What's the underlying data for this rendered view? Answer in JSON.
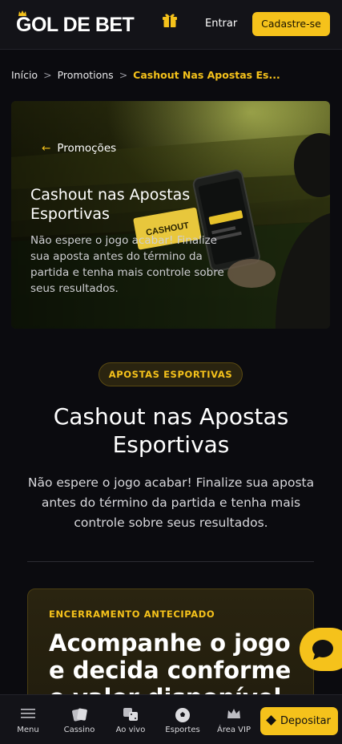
{
  "header": {
    "logo_text": "GOL DE BET",
    "login_label": "Entrar",
    "signup_label": "Cadastre-se",
    "accent_color": "#f5c21b"
  },
  "breadcrumb": {
    "items": [
      "Início",
      "Promotions",
      "Cashout Nas Apostas Es..."
    ],
    "separator": ">"
  },
  "hero": {
    "back_label": "Promoções",
    "title": "Cashout nas Apostas Esportivas",
    "description": "Não espere o jogo acabar! Finalize sua aposta antes do término da partida e tenha mais controle sobre seus resultados.",
    "image_ticket_text": "CASHOUT"
  },
  "main": {
    "badge": "APOSTAS ESPORTIVAS",
    "title": "Cashout nas Apostas Esportivas",
    "description": "Não espere o jogo acabar! Finalize sua aposta antes do término da partida e tenha mais controle sobre seus resultados."
  },
  "card": {
    "eyebrow": "ENCERRAMENTO ANTECIPADO",
    "title": "Acompanhe o jogo e decida conforme o valor disponível"
  },
  "bottom_nav": {
    "items": [
      {
        "label": "Menu",
        "icon": "menu-icon"
      },
      {
        "label": "Cassino",
        "icon": "cards-icon"
      },
      {
        "label": "Ao vivo",
        "icon": "dice-icon"
      },
      {
        "label": "Esportes",
        "icon": "soccer-ball-icon"
      },
      {
        "label": "Área VIP",
        "icon": "crown-icon"
      }
    ],
    "deposit_label": "Depositar"
  }
}
